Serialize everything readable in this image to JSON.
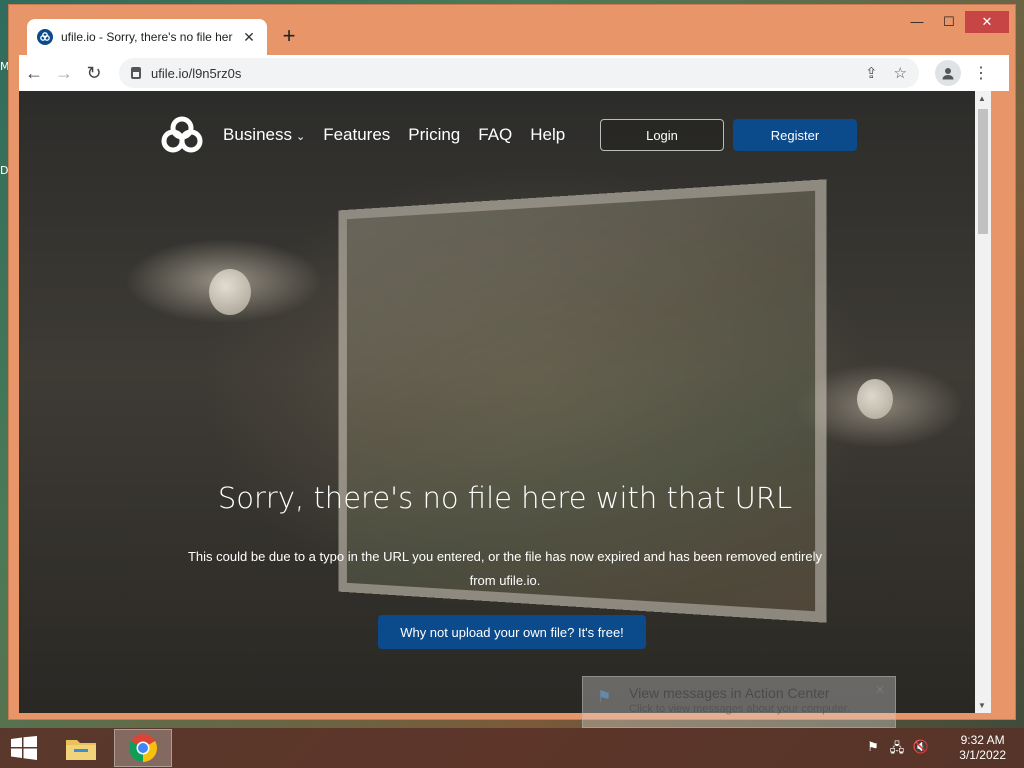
{
  "desktop": {
    "edge_labels": [
      "M",
      "D"
    ]
  },
  "browser": {
    "tab": {
      "title": "ufile.io - Sorry, there's no file her",
      "close_glyph": "✕"
    },
    "new_tab_glyph": "+",
    "window_controls": {
      "minimize": "—",
      "maximize": "☐",
      "close": "✕"
    },
    "nav": {
      "back": "←",
      "forward": "→",
      "reload": "↻"
    },
    "url": "ufile.io/l9n5rz0s",
    "omnibox_icons": {
      "share": "⇪",
      "bookmark": "☆"
    },
    "profile_glyph": "👤",
    "menu_glyph": "⋮"
  },
  "site": {
    "nav_links": [
      "Business",
      "Features",
      "Pricing",
      "FAQ",
      "Help"
    ],
    "business_caret": "⌄",
    "login_label": "Login",
    "register_label": "Register",
    "headline": "Sorry, there's no file here with that URL",
    "subtext": "This could be due to a typo in the URL you entered, or the file has now expired and has been removed entirely from ufile.io.",
    "cta_label": "Why not upload your own file? It's free!",
    "accent_color": "#0b4a8b"
  },
  "toast": {
    "title": "View messages in Action Center",
    "body": "Click to view messages about your computer.",
    "close_glyph": "✕"
  },
  "taskbar": {
    "items": [
      "file-explorer",
      "chrome"
    ],
    "tray_icons": [
      "action-center-flag-icon",
      "network-icon",
      "volume-muted-icon"
    ],
    "time": "9:32 AM",
    "date": "3/1/2022"
  }
}
